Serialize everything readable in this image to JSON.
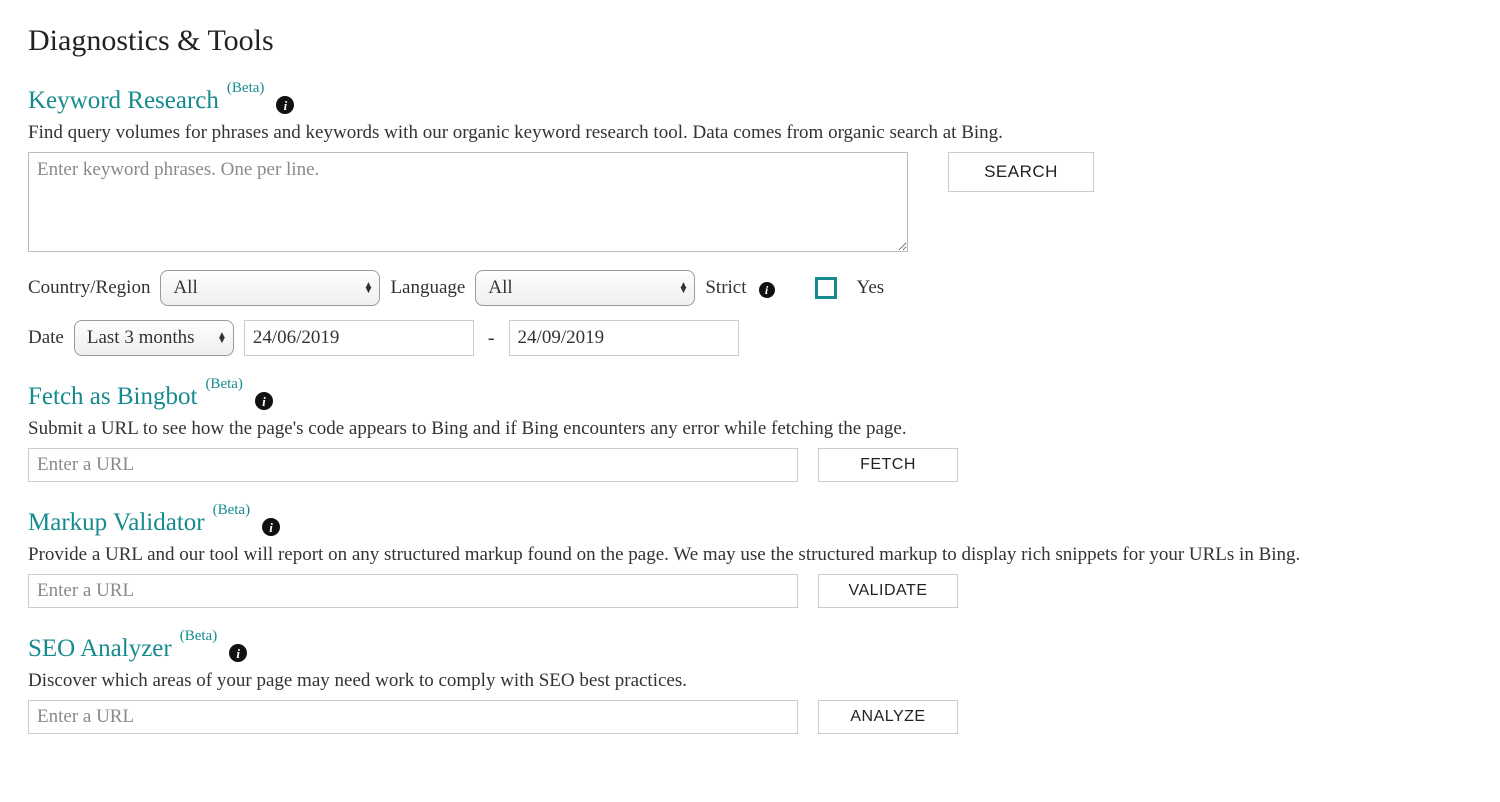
{
  "pageTitle": "Diagnostics & Tools",
  "betaTag": "(Beta)",
  "keywordResearch": {
    "title": "Keyword Research",
    "desc": "Find query volumes for phrases and keywords with our organic keyword research tool. Data comes from organic search at Bing.",
    "placeholder": "Enter keyword phrases. One per line.",
    "searchBtn": "SEARCH",
    "countryLabel": "Country/Region",
    "countryValue": "All",
    "languageLabel": "Language",
    "languageValue": "All",
    "strictLabel": "Strict",
    "yesLabel": "Yes",
    "dateLabel": "Date",
    "dateRangeValue": "Last 3 months",
    "dateFrom": "24/06/2019",
    "dateTo": "24/09/2019"
  },
  "fetchBingbot": {
    "title": "Fetch as Bingbot",
    "desc": "Submit a URL to see how the page's code appears to Bing and if Bing encounters any error while fetching the page.",
    "placeholder": "Enter a URL",
    "btn": "FETCH"
  },
  "markupValidator": {
    "title": "Markup Validator",
    "desc": "Provide a URL and our tool will report on any structured markup found on the page. We may use the structured markup to display rich snippets for your URLs in Bing.",
    "placeholder": "Enter a URL",
    "btn": "VALIDATE"
  },
  "seoAnalyzer": {
    "title": "SEO Analyzer",
    "desc": "Discover which areas of your page may need work to comply with SEO best practices.",
    "placeholder": "Enter a URL",
    "btn": "ANALYZE"
  }
}
